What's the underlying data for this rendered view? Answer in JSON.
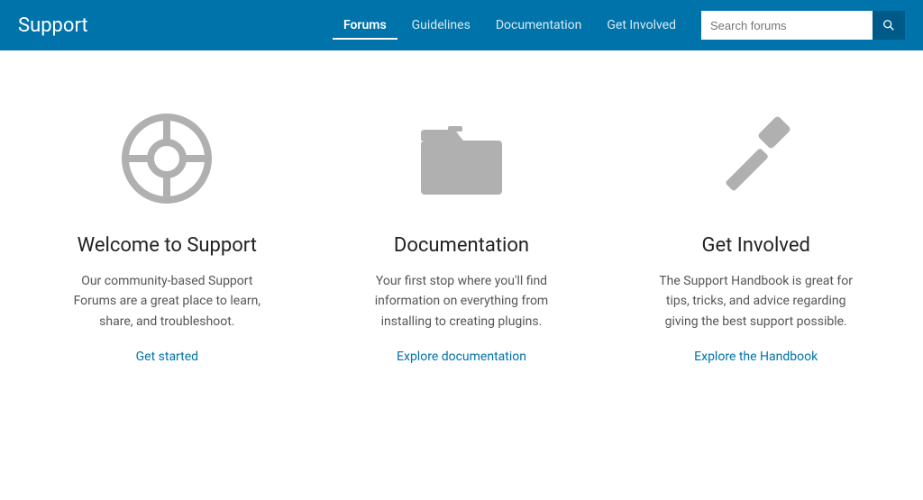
{
  "header": {
    "site_title": "Support",
    "nav": {
      "items": [
        {
          "label": "Forums",
          "active": true
        },
        {
          "label": "Guidelines",
          "active": false
        },
        {
          "label": "Documentation",
          "active": false
        },
        {
          "label": "Get Involved",
          "active": false
        }
      ]
    },
    "search": {
      "placeholder": "Search forums",
      "button_label": "🔍"
    }
  },
  "cards": [
    {
      "id": "welcome",
      "title": "Welcome to Support",
      "description": "Our community-based Support Forums are a great place to learn, share, and troubleshoot.",
      "link_label": "Get started",
      "icon": "wheel"
    },
    {
      "id": "documentation",
      "title": "Documentation",
      "description": "Your first stop where you'll find information on everything from installing to creating plugins.",
      "link_label": "Explore documentation",
      "icon": "folder"
    },
    {
      "id": "get-involved",
      "title": "Get Involved",
      "description": "The Support Handbook is great for tips, tricks, and advice regarding giving the best support possible.",
      "link_label": "Explore the Handbook",
      "icon": "hammer"
    }
  ]
}
